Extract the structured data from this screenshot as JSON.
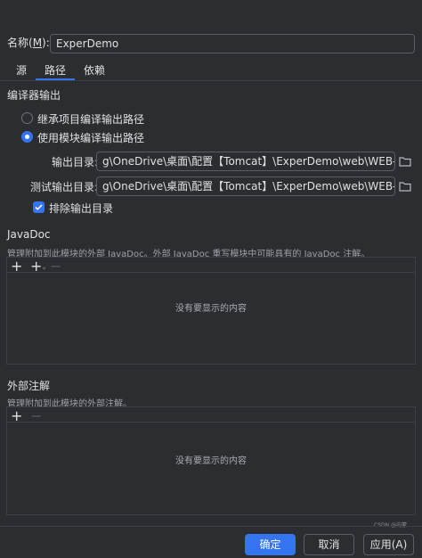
{
  "name": {
    "label": "名称(",
    "mnemonic": "M",
    "label_end": "):",
    "value": "ExperDemo"
  },
  "tabs": [
    "源",
    "路径",
    "依赖"
  ],
  "compiler_output": {
    "title": "编译器输出",
    "inherit_label": "继承项目编译输出路径",
    "use_module_label": "使用模块编译输出路径",
    "output_dir_label": "输出目录:",
    "output_dir_value": "g\\OneDrive\\桌面\\配置【Tomcat】\\ExperDemo\\web\\WEB-INF\\classes",
    "test_output_dir_label": "测试输出目录:",
    "test_output_dir_value": "g\\OneDrive\\桌面\\配置【Tomcat】\\ExperDemo\\web\\WEB-INF\\classes",
    "exclude_label": "排除输出目录",
    "exclude_checked": true
  },
  "javadoc": {
    "title": "JavaDoc",
    "desc": "管理附加到此模块的外部 JavaDoc。外部 JavaDoc 重写模块中可能具有的 JavaDoc 注解。",
    "empty_text": "没有要显示的内容"
  },
  "annotations": {
    "title": "外部注解",
    "desc": "管理附加到此模块的外部注解。",
    "empty_text": "没有要显示的内容"
  },
  "footer": {
    "ok": "确定",
    "cancel": "取消",
    "apply": "应用(A)",
    "watermark": "CSDN @内蒙"
  },
  "colors": {
    "accent": "#3574f0",
    "background": "#2b2d30"
  }
}
